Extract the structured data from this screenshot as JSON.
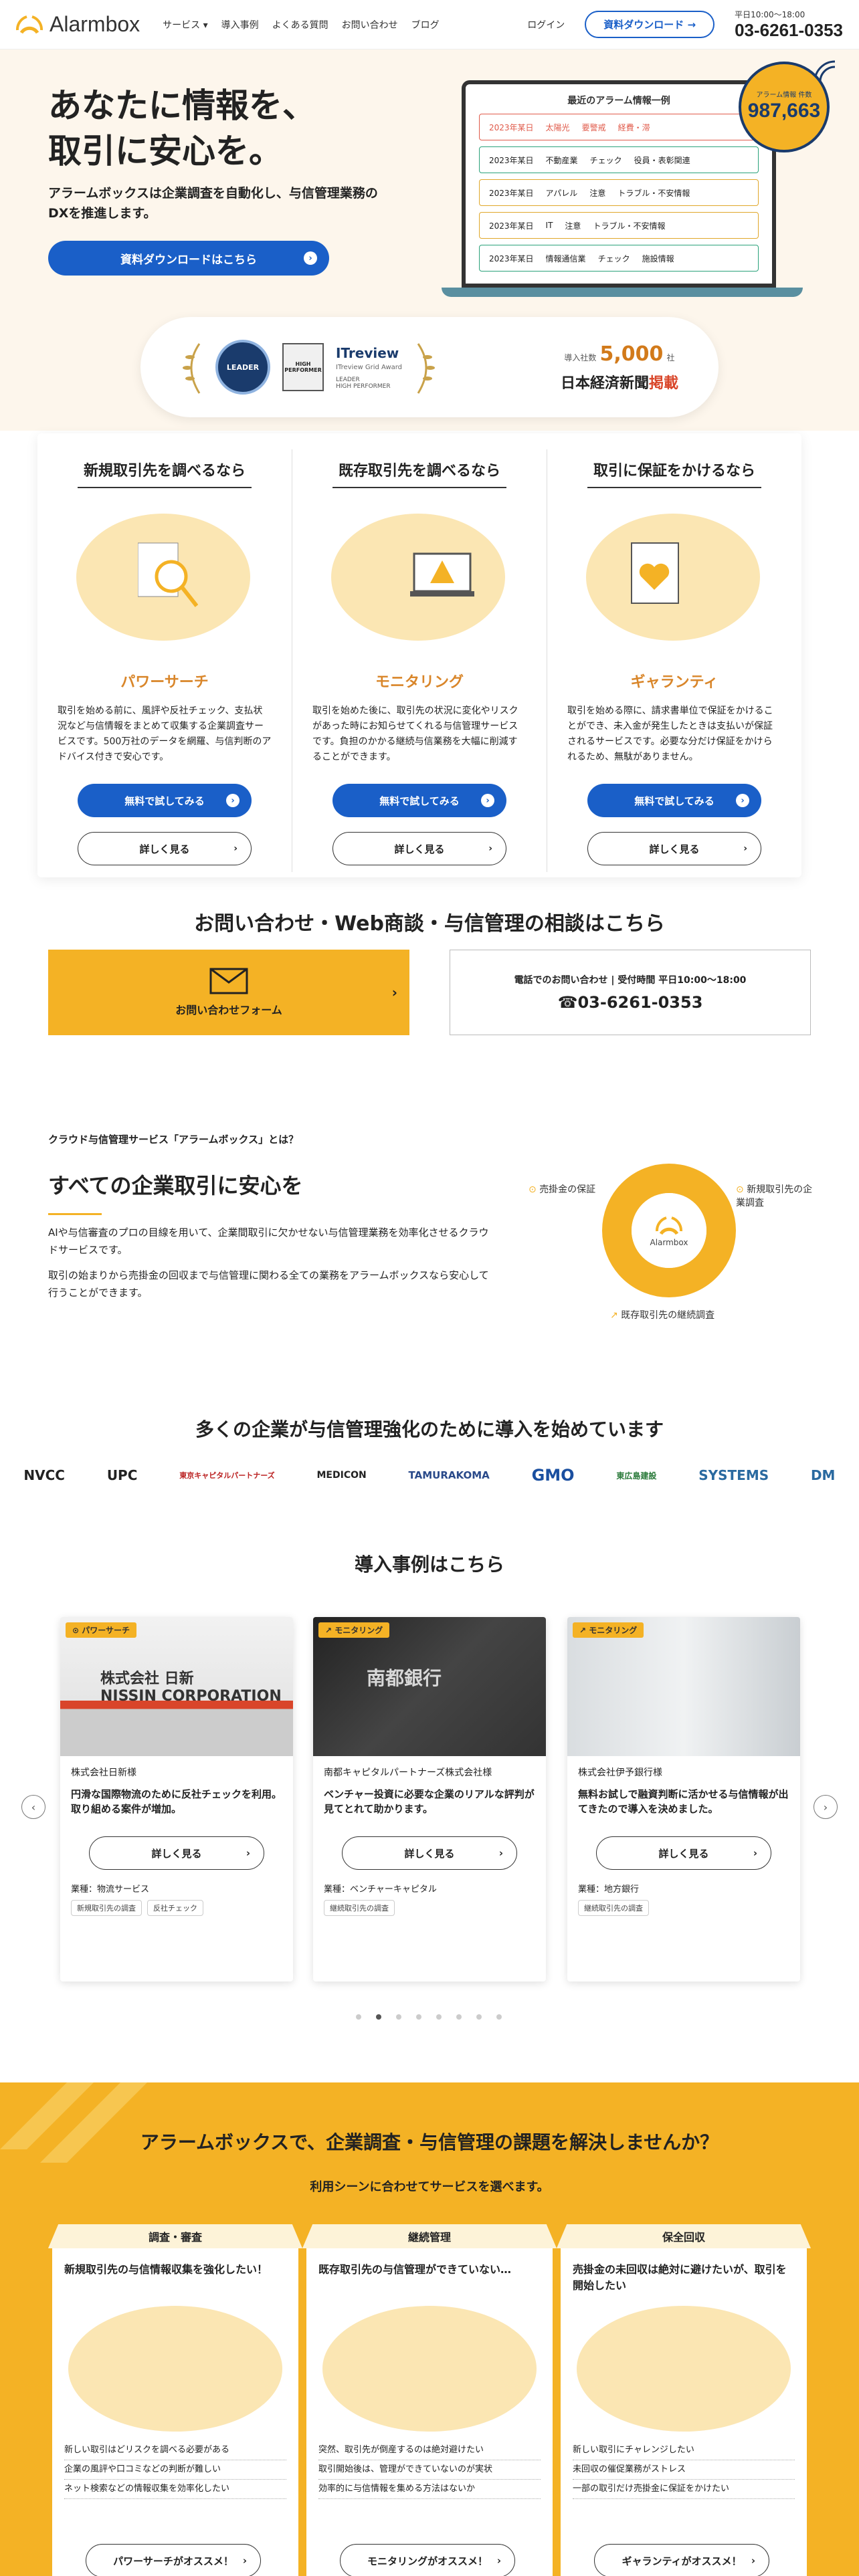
{
  "header": {
    "logo": "Alarmbox",
    "nav": [
      "サービス ▾",
      "導入事例",
      "よくある質問",
      "お問い合わせ",
      "ブログ"
    ],
    "login": "ログイン",
    "download": "資料ダウンロード →",
    "hours": "平日10:00〜18:00",
    "tel": "03-6261-0353"
  },
  "hero": {
    "title_line1": "あなたに情報を、",
    "title_line2": "取引に安心を。",
    "lead": "アラームボックスは企業調査を自動化し、与信管理業務のDXを推進します。",
    "cta": "資料ダウンロードはこちら",
    "screen_title": "最近のアラーム情報一例",
    "alerts": [
      {
        "date": "2023年某日",
        "industry": "太陽光",
        "tag": "要警戒",
        "detail": "経費・滞",
        "color": "#e05a4a"
      },
      {
        "date": "2023年某日",
        "industry": "不動産業",
        "tag": "チェック",
        "detail": "役員・表彰関連",
        "color": "#2aa27a"
      },
      {
        "date": "2023年某日",
        "industry": "アパレル",
        "tag": "注意",
        "detail": "トラブル・不安情報",
        "color": "#e0a72a"
      },
      {
        "date": "2023年某日",
        "industry": "IT",
        "tag": "注意",
        "detail": "トラブル・不安情報",
        "color": "#e0a72a"
      },
      {
        "date": "2023年某日",
        "industry": "情報通信業",
        "tag": "チェック",
        "detail": "施設情報",
        "color": "#2aa27a"
      }
    ],
    "badge_small": "アラーム情報\n件数",
    "badge_num": "987,663"
  },
  "awards": {
    "leader": "LEADER",
    "high_performer": "HIGH PERFORMER",
    "itreview": "ITreview",
    "caption1": "ITreview Grid Award",
    "label_leader": "LEADER",
    "label_hp": "HIGH PERFORMER",
    "count_prefix": "導入社数",
    "count": "5,000",
    "count_suffix": "社",
    "media_main": "日本経済新聞",
    "media_suffix": "掲載"
  },
  "features": [
    {
      "heading": "新規取引先を調べるなら",
      "name": "パワーサーチ",
      "desc": "取引を始める前に、風評や反社チェック、支払状況など与信情報をまとめて収集する企業調査サービスです。500万社のデータを網羅、与信判断のアドバイス付きで安心です。",
      "btn1": "無料で試してみる",
      "btn2": "詳しく見る"
    },
    {
      "heading": "既存取引先を調べるなら",
      "name": "モニタリング",
      "desc": "取引を始めた後に、取引先の状況に変化やリスクがあった時にお知らせてくれる与信管理サービスです。負担のかかる継続与信業務を大幅に削減することができます。",
      "btn1": "無料で試してみる",
      "btn2": "詳しく見る"
    },
    {
      "heading": "取引に保証をかけるなら",
      "name": "ギャランティ",
      "desc": "取引を始める際に、請求書単位で保証をかけることができ、未入金が発生したときは支払いが保証されるサービスです。必要な分だけ保証をかけられるため、無駄がありません。",
      "btn1": "無料で試してみる",
      "btn2": "詳しく見る"
    }
  ],
  "contact": {
    "heading": "お問い合わせ・Web商談・与信管理の相談はこちら",
    "form": "お問い合わせフォーム",
    "tel_label": "電話でのお問い合わせ | 受付時間 平日10:00〜18:00",
    "tel": "03-6261-0353"
  },
  "about": {
    "small": "クラウド与信管理サービス「アラームボックス」とは？",
    "heading": "すべての企業取引に安心を",
    "p1": "AIや与信審査のプロの目線を用いて、企業間取引に欠かせない与信管理業務を効率化させるクラウドサービスです。",
    "p2": "取引の始まりから売掛金の回収まで与信管理に関わる全ての業務をアラームボックスなら安心して行うことができます。",
    "cycle_center": "Alarmbox",
    "cycle_labels": [
      "売掛金の保証",
      "新規取引先の企業調査",
      "既存取引先の継続調査"
    ]
  },
  "logos": {
    "heading": "多くの企業が与信管理強化のために導入を始めています",
    "items": [
      "NVCC",
      "UPC",
      "東京キャピタルパートナーズ",
      "MEDICON",
      "TAMURAKOMA",
      "GMO",
      "東広島建設",
      "SYSTEMS",
      "DM"
    ]
  },
  "cases": {
    "heading": "導入事例はこちら",
    "items": [
      {
        "tag": "パワーサーチ",
        "company": "株式会社日新様",
        "text": "円滑な国際物流のために反社チェックを利用。取り組める案件が増加。",
        "btn": "詳しく見る",
        "industry": "業種：物流サービス",
        "tags": [
          "新規取引先の調査",
          "反社チェック"
        ],
        "photo_text": "株式会社 日新\nNISSIN CORPORATION"
      },
      {
        "tag": "モニタリング",
        "company": "南都キャピタルパートナーズ株式会社様",
        "text": "ベンチャー投資に必要な企業のリアルな評判が見てとれて助かります。",
        "btn": "詳しく見る",
        "industry": "業種：ベンチャーキャピタル",
        "tags": [
          "継続取引先の調査"
        ],
        "photo_text": "南都銀行"
      },
      {
        "tag": "モニタリング",
        "company": "株式会社伊予銀行様",
        "text": "無料お試しで融資判断に活かせる与信情報が出てきたので導入を決めました。",
        "btn": "詳しく見る",
        "industry": "業種：地方銀行",
        "tags": [
          "継続取引先の調査"
        ],
        "photo_text": ""
      }
    ]
  },
  "solutions": {
    "heading": "アラームボックスで、企業調査・与信管理の課題を解決しませんか？",
    "sub": "利用シーンに合わせてサービスを選べます。",
    "items": [
      {
        "head": "調査・審査",
        "title": "新規取引先の与信情報収集を強化したい！",
        "list": [
          "新しい取引はどリスクを調べる必要がある",
          "企業の風評や口コミなどの判断が難しい",
          "ネット検索などの情報収集を効率化したい"
        ],
        "btn": "パワーサーチがオススメ！"
      },
      {
        "head": "継続管理",
        "title": "既存取引先の与信管理ができていない…",
        "list": [
          "突然、取引先が倒産するのは絶対避けたい",
          "取引開始後は、管理ができていないのが実状",
          "効率的に与信情報を集める方法はないか"
        ],
        "btn": "モニタリングがオススメ！"
      },
      {
        "head": "保全回収",
        "title": "売掛金の未回収は絶対に避けたいが、取引を開始したい",
        "list": [
          "新しい取引にチャレンジしたい",
          "未回収の催促業務がストレス",
          "一部の取引だけ売掛金に保証をかけたい"
        ],
        "btn": "ギャランティがオススメ！"
      }
    ]
  },
  "colors": {
    "brand_yellow": "#f4b225",
    "brand_blue": "#1a5fc8",
    "hero_bg": "#fdf6ec"
  }
}
